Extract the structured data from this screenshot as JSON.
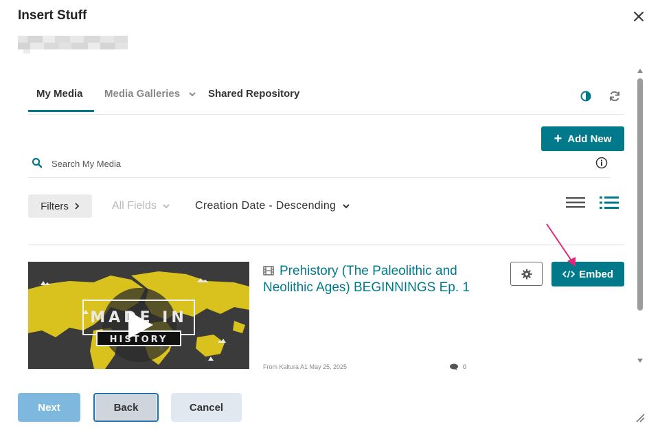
{
  "dialog": {
    "title": "Insert Stuff"
  },
  "tabs": {
    "my_media": "My Media",
    "media_galleries": "Media Galleries",
    "shared_repository": "Shared Repository"
  },
  "toolbar": {
    "add_new_label": "Add New"
  },
  "search": {
    "placeholder": "Search My Media"
  },
  "filters": {
    "filters_label": "Filters",
    "field_selector": "All Fields",
    "sort_selector": "Creation Date - Descending"
  },
  "media": {
    "title": "Prehistory (The Paleolithic and Neolithic Ages) BEGINNINGS Ep. 1",
    "meta": "From Kaltura A1 May 25, 2025",
    "comment_count": "0",
    "embed_label": "Embed",
    "thumbnail_text_1": "MADE IN",
    "thumbnail_text_2": "HISTORY"
  },
  "footer": {
    "next_label": "Next",
    "back_label": "Back",
    "cancel_label": "Cancel"
  },
  "colors": {
    "accent": "#00798a",
    "arrow": "#e0287a",
    "next_disabled": "#7fb8de"
  },
  "icons": [
    "close-icon",
    "contrast-icon",
    "refresh-icon",
    "plus-icon",
    "search-icon",
    "info-icon",
    "chevron-right-icon",
    "chevron-down-icon",
    "list-view-icon",
    "detailed-view-icon",
    "film-icon",
    "comment-icon",
    "gear-icon",
    "code-icon",
    "play-icon",
    "resize-handle-icon"
  ]
}
